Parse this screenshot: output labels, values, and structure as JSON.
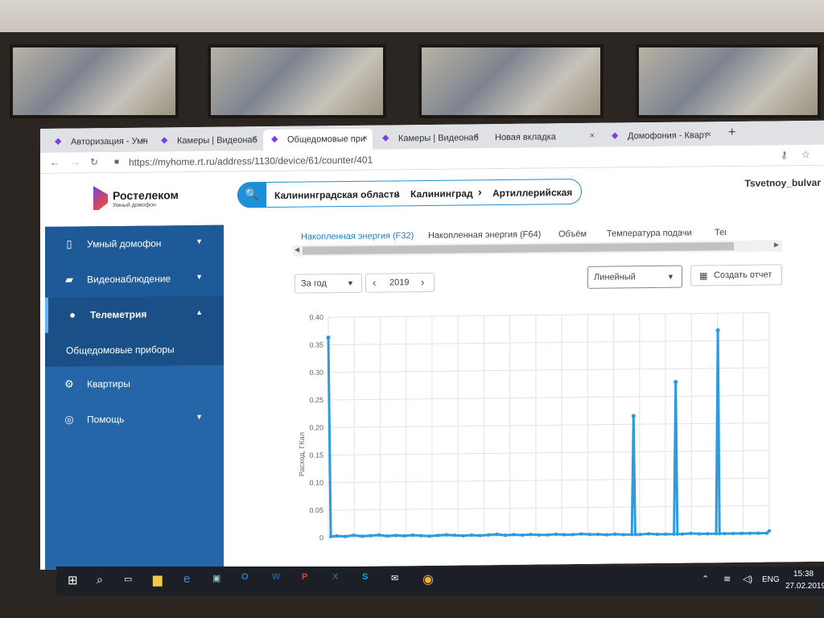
{
  "browser": {
    "tabs": [
      {
        "title": "Авторизация - Умн"
      },
      {
        "title": "Камеры | Видеонаб"
      },
      {
        "title": "Общедомовые при"
      },
      {
        "title": "Камеры | Видеонаб"
      },
      {
        "title": "Новая вкладка"
      },
      {
        "title": "Домофония - Кварт"
      }
    ],
    "new_tab": "+",
    "url": "https://myhome.rt.ru/address/1130/device/61/counter/401"
  },
  "header": {
    "logo_name": "Ростелеком",
    "logo_sub": "Умный домофон",
    "breadcrumb": [
      "Калининградская область",
      "Калининград",
      "Артиллерийская"
    ],
    "user": "Tsvetnoy_bulvar"
  },
  "sidebar": {
    "items": [
      {
        "label": "Умный домофон",
        "icon": "phone-icon"
      },
      {
        "label": "Видеонаблюдение",
        "icon": "camera-icon"
      },
      {
        "label": "Телеметрия",
        "icon": "user-icon"
      },
      {
        "label": "Общедомовые приборы"
      },
      {
        "label": "Квартиры",
        "icon": "gear-icon"
      },
      {
        "label": "Помощь",
        "icon": "lifebuoy-icon"
      }
    ]
  },
  "main": {
    "tabs": [
      "Накопленная энергия (F32)",
      "Накопленная энергия (F64)",
      "Объём",
      "Температура подачи",
      "Температура об"
    ],
    "period_select": "За год",
    "year": "2019",
    "chart_type_select": "Линейный",
    "report_button": "Создать отчет"
  },
  "taskbar": {
    "lang": "ENG",
    "time": "15:38",
    "date": "27.02.2019"
  },
  "chart_data": {
    "type": "line",
    "ylabel": "Расход, ГКал",
    "ylim": [
      0,
      0.4
    ],
    "yticks": [
      "0.40",
      "0.35",
      "0.30",
      "0.25",
      "0.20",
      "0.15",
      "0.10",
      "0.05",
      "0"
    ],
    "series": [
      {
        "color": "#2d9bde",
        "x": [
          0,
          0.3,
          1,
          2,
          3,
          4,
          5,
          6,
          7,
          8,
          9,
          10,
          11,
          12,
          13,
          14,
          15,
          16,
          17,
          18,
          19,
          20,
          21,
          22,
          23,
          24,
          25,
          26,
          27,
          28,
          29,
          30,
          31,
          32,
          33,
          34,
          35,
          36,
          36.2,
          36.4,
          37,
          38,
          39,
          40,
          41,
          41.2,
          41.4,
          42,
          43,
          44,
          45,
          46,
          46.2,
          46.4,
          47,
          48,
          49,
          50,
          51,
          52,
          52.3
        ],
        "values": [
          0.363,
          0.002,
          0.003,
          0.002,
          0.004,
          0.002,
          0.003,
          0.004,
          0.002,
          0.003,
          0.002,
          0.003,
          0.002,
          0.001,
          0.002,
          0.003,
          0.002,
          0.001,
          0.002,
          0.001,
          0.002,
          0.003,
          0.001,
          0.002,
          0.001,
          0.002,
          0.001,
          0.001,
          0.002,
          0.001,
          0.001,
          0.002,
          0.001,
          0.001,
          0.0,
          0.001,
          0.0,
          0.0,
          0.215,
          0.0,
          0.0,
          0.001,
          0.0,
          0.0,
          0.0,
          0.276,
          0.0,
          0.0,
          0.001,
          0.0,
          0.0,
          0.0,
          0.369,
          0.0,
          0.0,
          0.0,
          0.0,
          0.0,
          0.0,
          0.0,
          0.004
        ]
      }
    ]
  }
}
